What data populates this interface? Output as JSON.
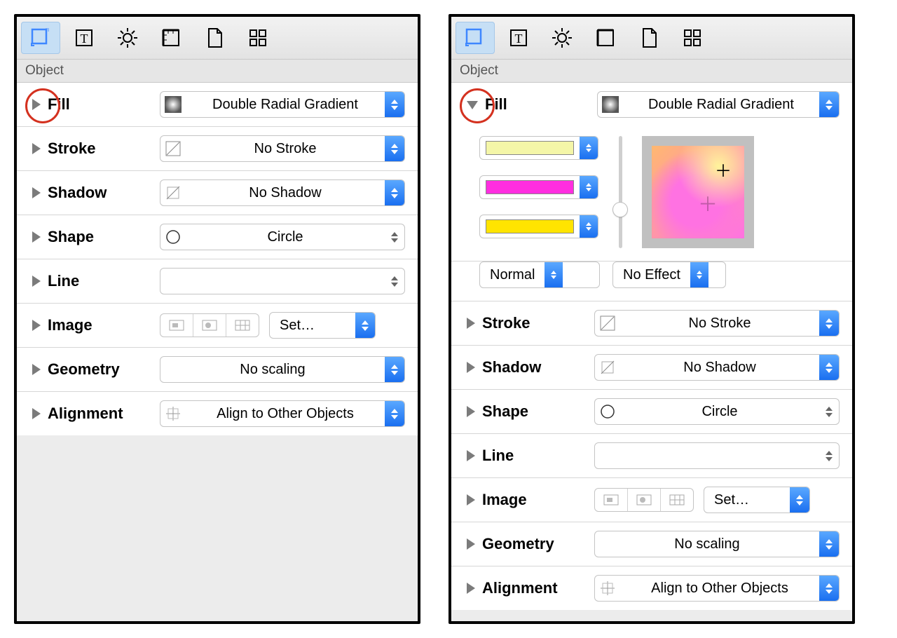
{
  "section_title": "Object",
  "tabs": {
    "icons": [
      "object-icon",
      "type-icon",
      "gear-icon",
      "ruler-icon",
      "page-icon",
      "grid-icon"
    ],
    "selected": 0
  },
  "rows": {
    "fill": {
      "label": "Fill",
      "value": "Double Radial Gradient"
    },
    "stroke": {
      "label": "Stroke",
      "value": "No Stroke"
    },
    "shadow": {
      "label": "Shadow",
      "value": "No Shadow"
    },
    "shape": {
      "label": "Shape",
      "value": "Circle"
    },
    "line": {
      "label": "Line",
      "value": ""
    },
    "image": {
      "label": "Image",
      "set_label": "Set…"
    },
    "geometry": {
      "label": "Geometry",
      "value": "No scaling"
    },
    "alignment": {
      "label": "Alignment",
      "value": "Align to Other Objects"
    }
  },
  "fill_detail": {
    "swatch_colors": [
      "#f4f6a8",
      "#ff2ee0",
      "#ffe400"
    ],
    "blend_mode": "Normal",
    "effect": "No Effect"
  }
}
